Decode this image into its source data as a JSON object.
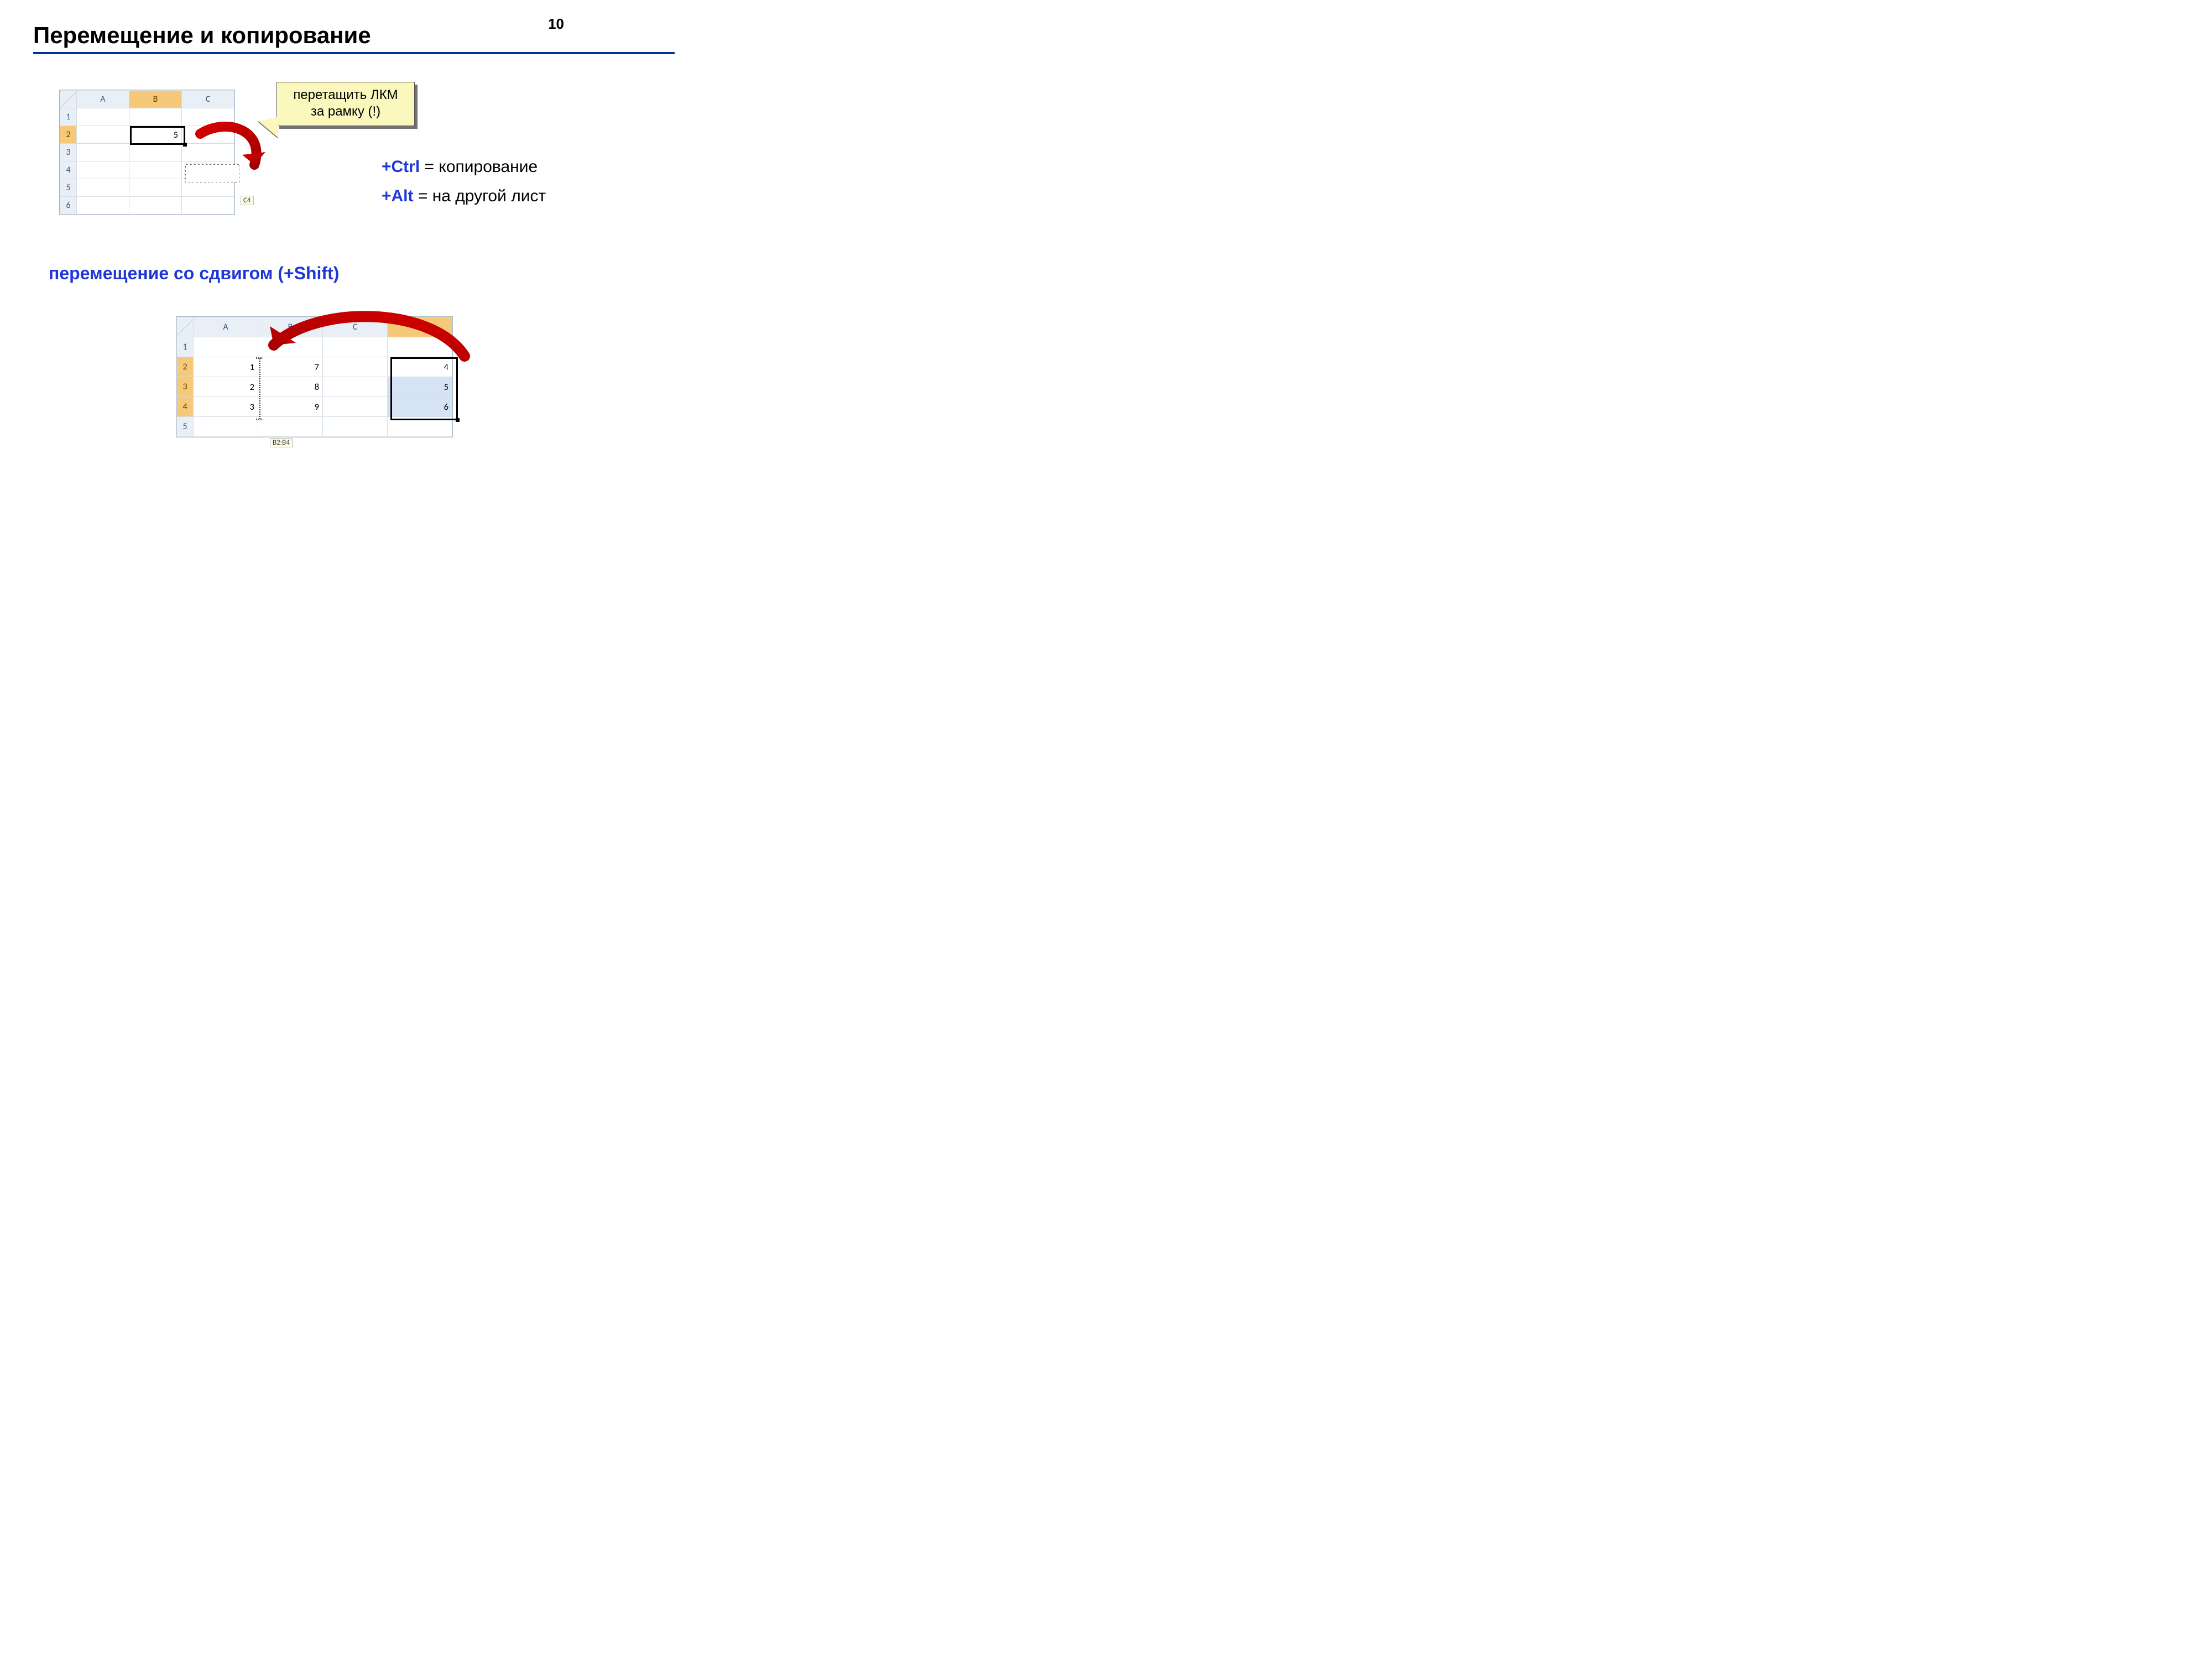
{
  "page_number": "10",
  "title": "Перемещение и копирование",
  "callout": {
    "line1": "перетащить ЛКМ",
    "line2": "за рамку (!)"
  },
  "notes": {
    "ctrl_key": "+Ctrl",
    "ctrl_text": " = копирование",
    "alt_key": "+Alt",
    "alt_text": " = на другой лист"
  },
  "subtitle": "перемещение со сдвигом (+Shift)",
  "grid1": {
    "columns": [
      "A",
      "B",
      "C"
    ],
    "rows": [
      "1",
      "2",
      "3",
      "4",
      "5",
      "6"
    ],
    "selected_col": "B",
    "selected_row": "2",
    "cell_b2": "5",
    "drag_tip": "C4"
  },
  "grid2": {
    "columns": [
      "A",
      "B",
      "C",
      "D"
    ],
    "rows": [
      "1",
      "2",
      "3",
      "4",
      "5"
    ],
    "selected_col": "D",
    "data": {
      "A": [
        "1",
        "2",
        "3"
      ],
      "B": [
        "7",
        "8",
        "9"
      ],
      "D": [
        "4",
        "5",
        "6"
      ]
    },
    "drag_tip": "B2:B4"
  }
}
